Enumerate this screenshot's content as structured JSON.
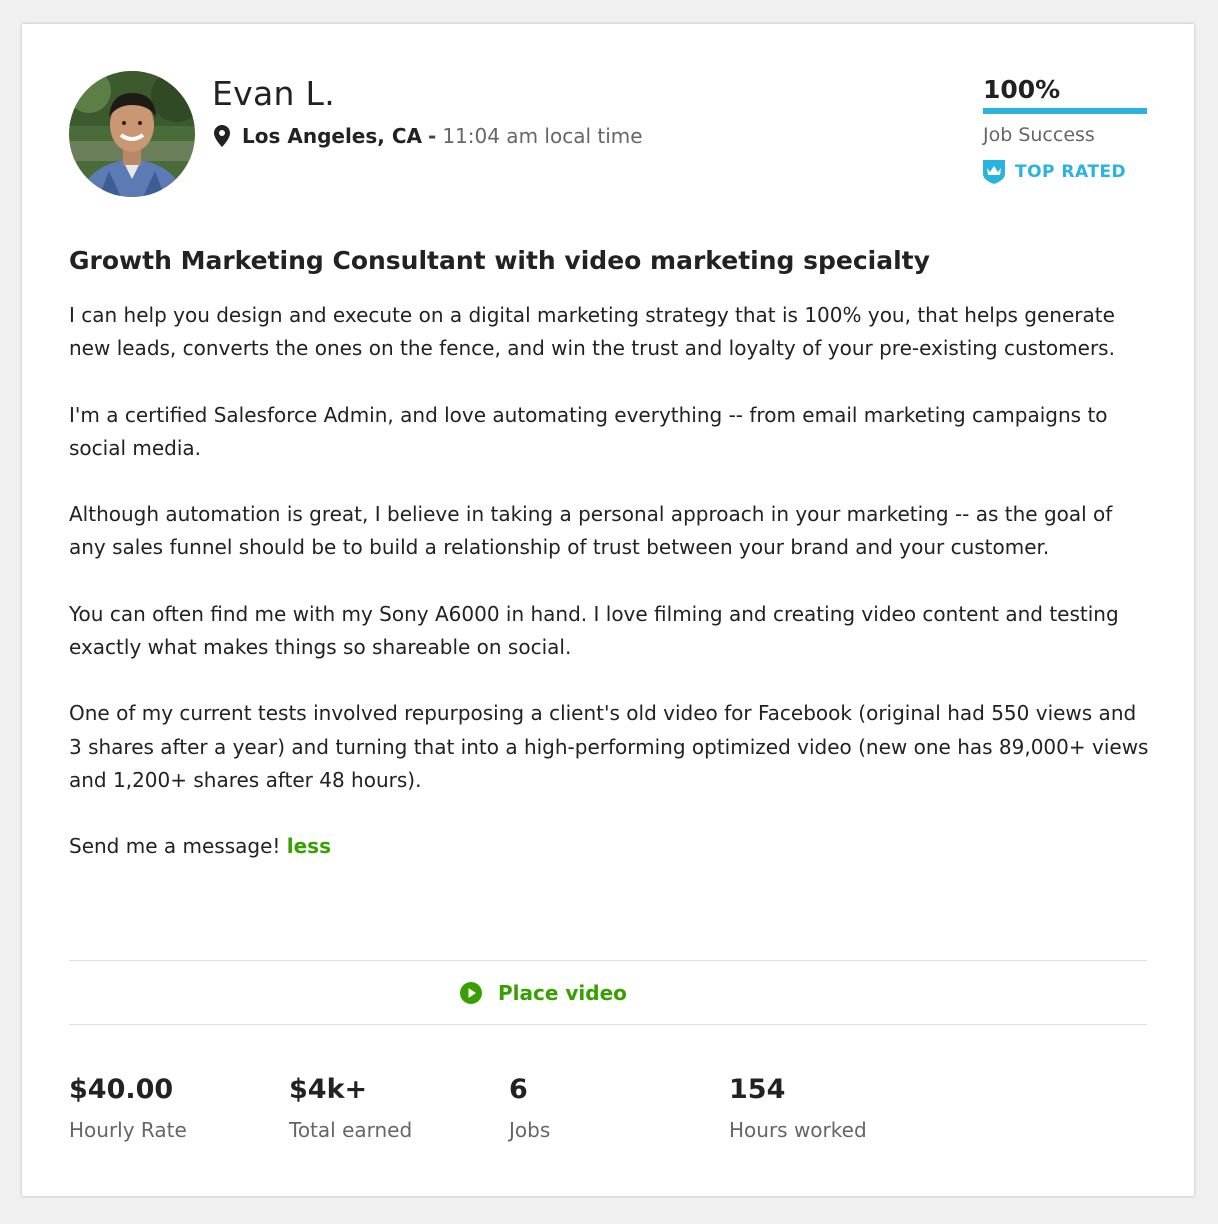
{
  "profile": {
    "name": "Evan L.",
    "location": "Los Angeles, CA",
    "separator": "-",
    "local_time": "11:04 am local time"
  },
  "job_success": {
    "percent_text": "100%",
    "percent_value": 100,
    "label": "Job Success",
    "badge": "TOP RATED",
    "accent_color": "#2bb3e0"
  },
  "overview": {
    "title": "Growth Marketing Consultant with video marketing specialty",
    "paragraphs": [
      "I can help you design and execute on a digital marketing strategy that is 100% you, that helps generate new leads, converts the ones on the fence, and win the trust and loyalty of your pre-existing customers.",
      "I'm a certified Salesforce Admin, and love automating everything -- from email marketing campaigns to social media.",
      "Although automation is great, I believe in taking a personal approach in your marketing -- as the goal of any sales funnel should be to build a relationship of trust between your brand and your customer.",
      "You can often find me with my Sony A6000 in hand. I love filming and creating video content and testing exactly what makes things so shareable on social.",
      "One of my current tests involved repurposing a client's old video for Facebook (original had 550 views and 3 shares after a year) and turning that into a high-performing optimized video (new one has 89,000+ views and 1,200+ shares after 48 hours)."
    ],
    "closing": "Send me a message!",
    "less_link": "less",
    "link_color": "#37a000"
  },
  "video": {
    "label": "Place video",
    "icon": "play-circle-icon"
  },
  "stats": [
    {
      "value": "$40.00",
      "label": "Hourly Rate"
    },
    {
      "value": "$4k+",
      "label": "Total earned"
    },
    {
      "value": "6",
      "label": "Jobs"
    },
    {
      "value": "154",
      "label": "Hours worked"
    }
  ]
}
